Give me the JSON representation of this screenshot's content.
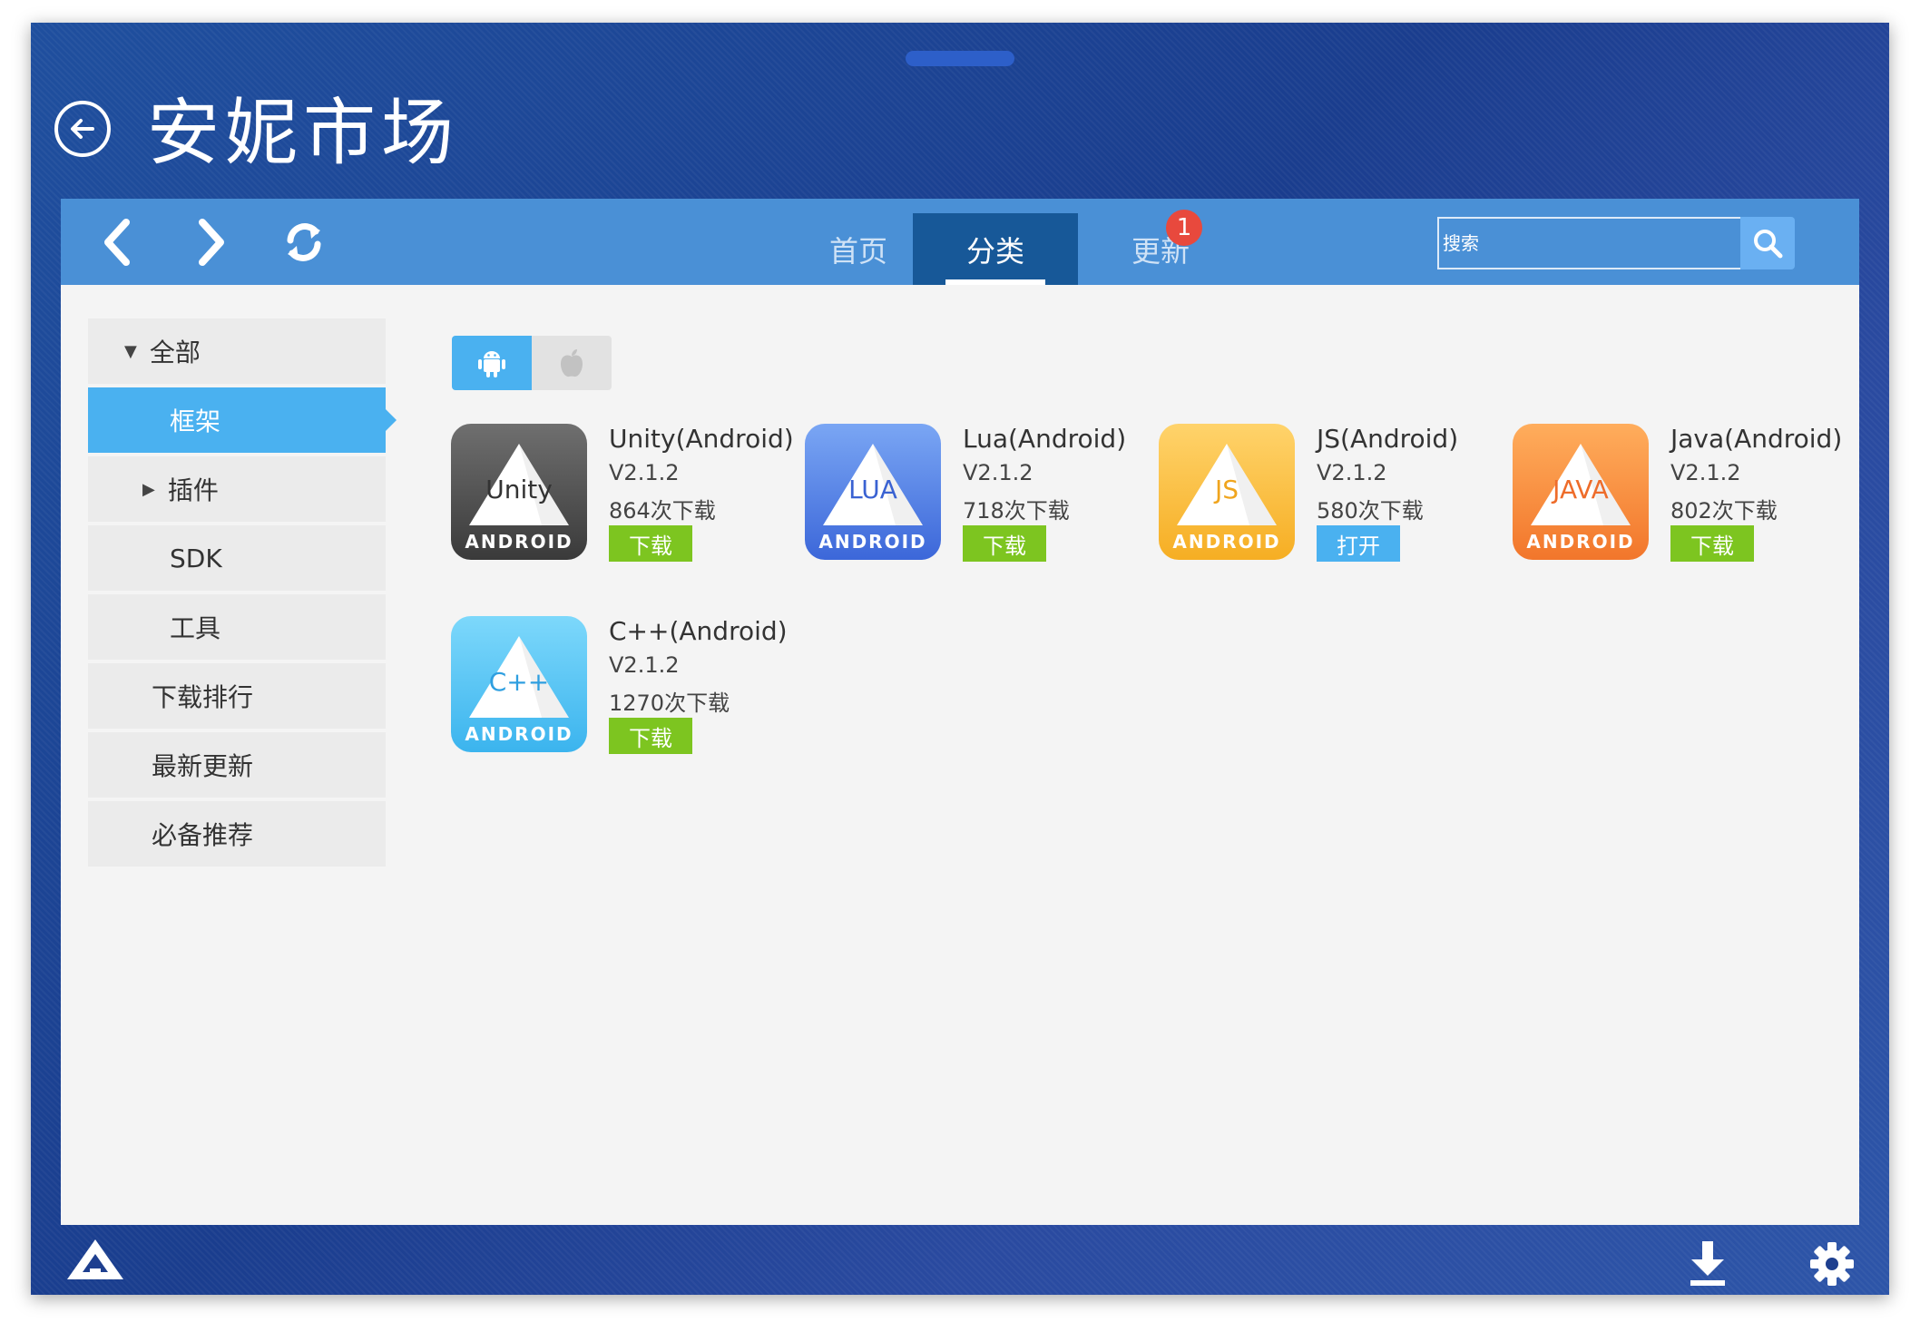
{
  "app": {
    "title": "安妮市场"
  },
  "toolbar": {
    "tabs": [
      {
        "label": "首页"
      },
      {
        "label": "分类"
      },
      {
        "label": "更新"
      }
    ],
    "update_badge": "1",
    "search_placeholder": "搜索"
  },
  "sidebar": {
    "items": [
      {
        "label": "全部"
      },
      {
        "label": "框架"
      },
      {
        "label": "插件"
      },
      {
        "label": "SDK"
      },
      {
        "label": "工具"
      },
      {
        "label": "下载排行"
      },
      {
        "label": "最新更新"
      },
      {
        "label": "必备推荐"
      }
    ]
  },
  "apps": [
    {
      "name": "Unity(Android)",
      "version": "V2.1.2",
      "downloads": "864次下载",
      "action": "下载",
      "icon_text": "Unity",
      "icon_bottom": "ANDROID",
      "colors": [
        "#6f6f6f",
        "#3a3a3a"
      ],
      "text_color": "#333333"
    },
    {
      "name": "Lua(Android)",
      "version": "V2.1.2",
      "downloads": "718次下载",
      "action": "下载",
      "icon_text": "LUA",
      "icon_bottom": "ANDROID",
      "colors": [
        "#7aa6f4",
        "#3c67d9"
      ],
      "text_color": "#3a62d2"
    },
    {
      "name": "JS(Android)",
      "version": "V2.1.2",
      "downloads": "580次下载",
      "action": "打开",
      "icon_text": "JS",
      "icon_bottom": "ANDROID",
      "colors": [
        "#ffd36b",
        "#f6ae23"
      ],
      "text_color": "#f0a51e"
    },
    {
      "name": "Java(Android)",
      "version": "V2.1.2",
      "downloads": "802次下载",
      "action": "下载",
      "icon_text": "JAVA",
      "icon_bottom": "ANDROID",
      "colors": [
        "#ffad5c",
        "#f2762b"
      ],
      "text_color": "#ee6c2a"
    },
    {
      "name": "C++(Android)",
      "version": "V2.1.2",
      "downloads": "1270次下载",
      "action": "下载",
      "icon_text": "C++",
      "icon_bottom": "ANDROID",
      "colors": [
        "#7dd8fb",
        "#3bb4ee"
      ],
      "text_color": "#2f9fe0"
    }
  ]
}
